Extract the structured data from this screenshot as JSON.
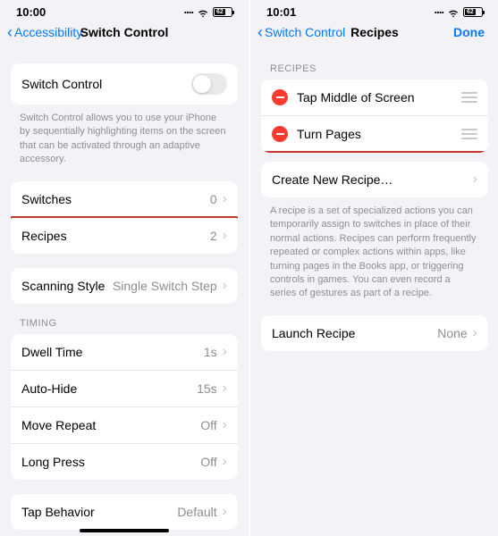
{
  "left": {
    "time": "10:00",
    "battery": "62",
    "back_label": "Accessibility",
    "title": "Switch Control",
    "main_row": "Switch Control",
    "main_footer": "Switch Control allows you to use your iPhone by sequentially highlighting items on the screen that can be activated through an adaptive accessory.",
    "switches_label": "Switches",
    "switches_value": "0",
    "recipes_label": "Recipes",
    "recipes_value": "2",
    "scanning_label": "Scanning Style",
    "scanning_value": "Single Switch Step",
    "timing_header": "TIMING",
    "dwell_label": "Dwell Time",
    "dwell_value": "1s",
    "autohide_label": "Auto-Hide",
    "autohide_value": "15s",
    "move_label": "Move Repeat",
    "move_value": "Off",
    "long_label": "Long Press",
    "long_value": "Off",
    "tapb_label": "Tap Behavior",
    "tapb_value": "Default"
  },
  "right": {
    "time": "10:01",
    "battery": "62",
    "back_label": "Switch Control",
    "title": "Recipes",
    "done": "Done",
    "recipes_header": "RECIPES",
    "recipe1": "Tap Middle of Screen",
    "recipe2": "Turn Pages",
    "create_label": "Create New Recipe…",
    "footer_text": "A recipe is a set of specialized actions you can temporarily assign to switches in place of their normal actions. Recipes can perform frequently repeated or complex actions within apps, like turning pages in the Books app, or triggering controls in games. You can even record a series of gestures as part of a recipe.",
    "launch_label": "Launch Recipe",
    "launch_value": "None"
  }
}
